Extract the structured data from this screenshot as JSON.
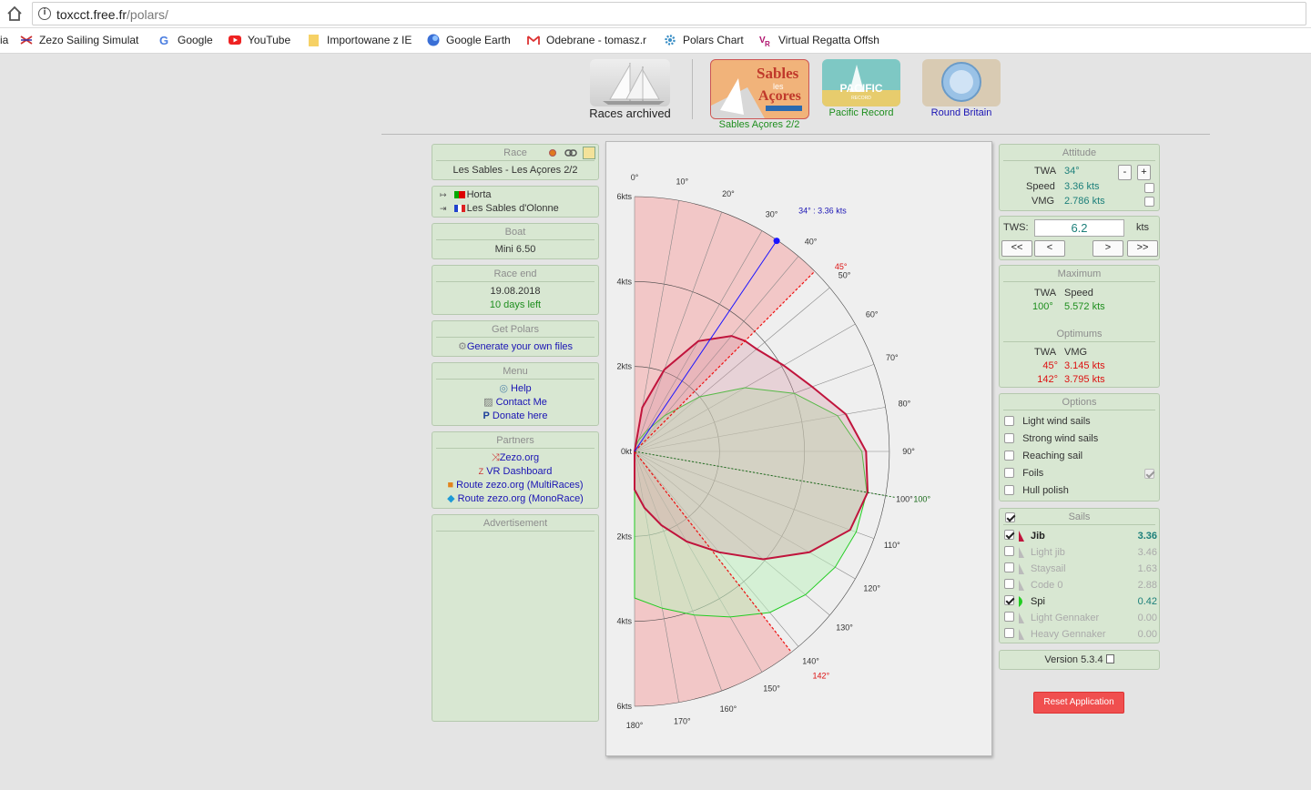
{
  "browser": {
    "url_host": "toxcct.free.fr",
    "url_path": "/polars/",
    "bookmarks": [
      {
        "label": "ia",
        "icon": "none"
      },
      {
        "label": "Zezo Sailing Simulat",
        "icon": "zezo-icon"
      },
      {
        "label": "Google",
        "icon": "google-icon"
      },
      {
        "label": "YouTube",
        "icon": "youtube-icon"
      },
      {
        "label": "Importowane z IE",
        "icon": "folder-icon"
      },
      {
        "label": "Google Earth",
        "icon": "earth-icon"
      },
      {
        "label": "Odebrane - tomasz.r",
        "icon": "gmail-icon"
      },
      {
        "label": "Polars Chart",
        "icon": "gear-icon"
      },
      {
        "label": "Virtual Regatta Offsh",
        "icon": "vr-icon"
      }
    ]
  },
  "races": {
    "archived_label": "Races archived",
    "items": [
      {
        "label": "Sables Açores 2/2",
        "tile_text_1": "Sables",
        "tile_text_2": "les",
        "tile_text_3": "Açores"
      },
      {
        "label": "Pacific Record",
        "tile_text_1": "PACIFIC",
        "tile_text_2": "RECORD"
      },
      {
        "label": "Round Britain"
      }
    ]
  },
  "left": {
    "race_title": "Race",
    "race_name": "Les Sables - Les Açores 2/2",
    "route_from": "Horta",
    "route_to": "Les Sables d'Olonne",
    "boat_title": "Boat",
    "boat_name": "Mini 6.50",
    "race_end_title": "Race end",
    "race_end_date": "19.08.2018",
    "race_end_left": "10 days left",
    "get_polars_title": "Get Polars",
    "get_polars_link": "Generate your own files",
    "menu_title": "Menu",
    "menu_help": "Help",
    "menu_contact": "Contact Me",
    "menu_donate": "Donate here",
    "partners_title": "Partners",
    "partners": [
      "Zezo.org",
      "VR Dashboard",
      "Route zezo.org (MultiRaces)",
      "Route zezo.org (MonoRace)"
    ],
    "ad_title": "Advertisement"
  },
  "right": {
    "attitude_title": "Attitude",
    "twa_label": "TWA",
    "twa_value": "34°",
    "speed_label": "Speed",
    "speed_value": "3.36 kts",
    "vmg_label": "VMG",
    "vmg_value": "2.786 kts",
    "minus": "-",
    "plus": "+",
    "tws_label": "TWS:",
    "tws_value": "6.2",
    "tws_unit": "kts",
    "nav_first": "<<",
    "nav_prev": "<",
    "nav_next": ">",
    "nav_last": ">>",
    "maximum_title": "Maximum",
    "max_twa_h": "TWA",
    "max_speed_h": "Speed",
    "max_twa": "100°",
    "max_speed": "5.572 kts",
    "optimums_title": "Optimums",
    "opt_twa_h": "TWA",
    "opt_vmg_h": "VMG",
    "opt_rows": [
      {
        "twa": "45°",
        "vmg": "3.145 kts"
      },
      {
        "twa": "142°",
        "vmg": "3.795 kts"
      }
    ],
    "options_title": "Options",
    "options": [
      {
        "label": "Light wind sails",
        "checked": false
      },
      {
        "label": "Strong wind sails",
        "checked": false
      },
      {
        "label": "Reaching sail",
        "checked": false
      },
      {
        "label": "Foils",
        "checked": false
      },
      {
        "label": "Hull polish",
        "checked": false
      }
    ],
    "sails_title": "Sails",
    "sails": [
      {
        "name": "Jib",
        "value": "3.36",
        "checked": true,
        "active": true,
        "color": "#c0143c"
      },
      {
        "name": "Light jib",
        "value": "3.46",
        "checked": false,
        "active": false,
        "color": "#bbbbbb"
      },
      {
        "name": "Staysail",
        "value": "1.63",
        "checked": false,
        "active": false,
        "color": "#bbbbbb"
      },
      {
        "name": "Code 0",
        "value": "2.88",
        "checked": false,
        "active": false,
        "color": "#bbbbbb"
      },
      {
        "name": "Spi",
        "value": "0.42",
        "checked": true,
        "active": false,
        "color": "#22cc22"
      },
      {
        "name": "Light Gennaker",
        "value": "0.00",
        "checked": false,
        "active": false,
        "color": "#bbbbbb"
      },
      {
        "name": "Heavy Gennaker",
        "value": "0.00",
        "checked": false,
        "active": false,
        "color": "#bbbbbb"
      }
    ],
    "version": "Version 5.3.4",
    "reset": "Reset Application"
  },
  "chart_data": {
    "type": "polar",
    "speed_ticks": [
      "0kt",
      "2kts",
      "4kts",
      "6kts"
    ],
    "speed_max": 6,
    "angle_ticks": [
      0,
      10,
      20,
      30,
      40,
      50,
      60,
      70,
      80,
      90,
      100,
      110,
      120,
      130,
      140,
      150,
      160,
      170,
      180
    ],
    "cursor": {
      "twa": 34,
      "speed": 3.36,
      "label": "34° : 3.36 kts"
    },
    "optimum_upwind": {
      "twa": 45,
      "label": "45°"
    },
    "optimum_downwind": {
      "twa": 142,
      "label": "142°"
    },
    "max_marker": {
      "twa": 100,
      "label": "100°"
    },
    "colors": {
      "jib": "#c0143c",
      "spi": "#22cc22",
      "cursor": "#1a14ff",
      "optimum": "#ee1111",
      "max": "#1a6a1a"
    },
    "series": [
      {
        "name": "Jib",
        "twa": [
          0,
          10,
          20,
          30,
          40,
          45,
          50,
          60,
          70,
          80,
          90,
          100,
          110,
          120,
          130,
          140,
          150,
          160,
          170,
          180
        ],
        "speed": [
          0,
          1.05,
          2.05,
          3.0,
          3.55,
          3.68,
          3.75,
          4.05,
          4.45,
          5.05,
          5.45,
          5.57,
          5.4,
          4.75,
          3.95,
          3.1,
          2.45,
          1.85,
          1.35,
          0.9
        ]
      },
      {
        "name": "Spi",
        "twa": [
          0,
          10,
          20,
          30,
          40,
          50,
          60,
          70,
          80,
          90,
          100,
          110,
          120,
          130,
          140,
          150,
          160,
          170,
          180
        ],
        "speed": [
          0,
          0.12,
          0.28,
          0.55,
          1.1,
          2.0,
          3.0,
          4.0,
          4.85,
          5.35,
          5.55,
          5.55,
          5.45,
          5.25,
          4.95,
          4.5,
          4.1,
          3.75,
          3.45
        ]
      }
    ]
  }
}
